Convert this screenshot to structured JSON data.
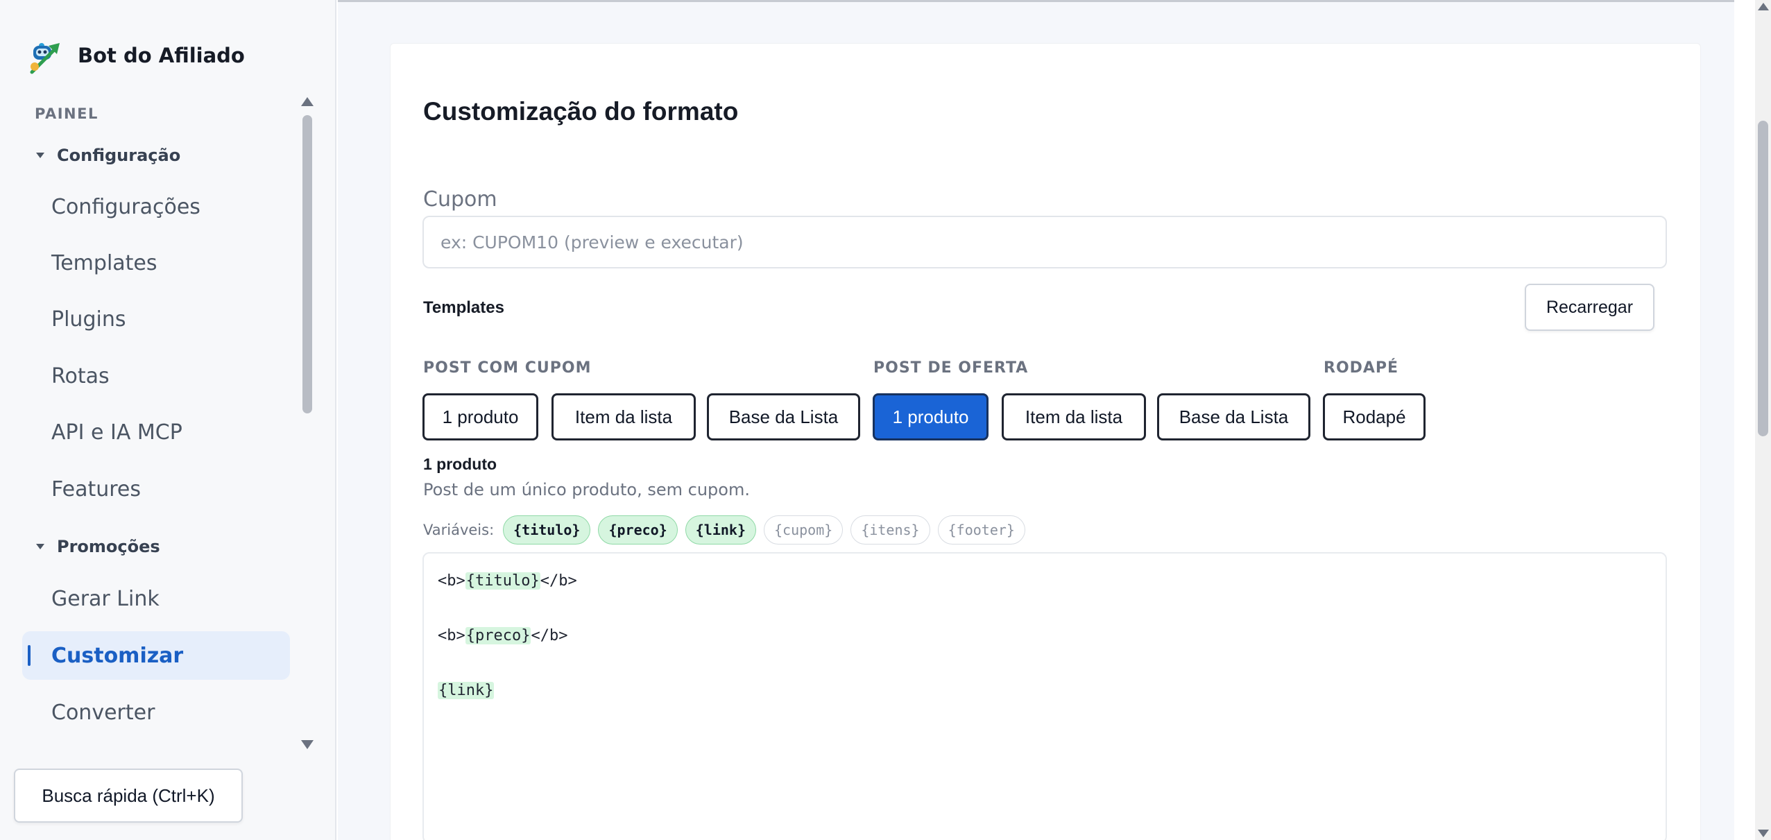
{
  "sidebar": {
    "brand_title": "Bot do Afiliado",
    "section_label": "PAINEL",
    "groups": [
      {
        "label": "Configuração",
        "items": [
          "Configurações",
          "Templates",
          "Plugins",
          "Rotas",
          "API e IA MCP",
          "Features"
        ]
      },
      {
        "label": "Promoções",
        "items": [
          "Gerar Link",
          "Customizar",
          "Converter"
        ]
      }
    ],
    "active_item": "Customizar",
    "quick_search_label": "Busca rápida (Ctrl+K)"
  },
  "main": {
    "page_title": "Customização do formato",
    "coupon": {
      "label": "Cupom",
      "placeholder": "ex: CUPOM10 (preview e executar)",
      "value": ""
    },
    "templates_section": {
      "title": "Templates",
      "reload_label": "Recarregar",
      "groups": [
        {
          "label": "POST COM CUPOM",
          "buttons": [
            "1 produto",
            "Item da lista",
            "Base da Lista"
          ]
        },
        {
          "label": "POST DE OFERTA",
          "buttons": [
            "1 produto",
            "Item da lista",
            "Base da Lista"
          ]
        },
        {
          "label": "RODAPÉ",
          "buttons": [
            "Rodapé"
          ]
        }
      ],
      "selected": "POST DE OFERTA / 1 produto"
    },
    "selected_template": {
      "name": "1 produto",
      "description": "Post de um único produto, sem cupom.",
      "variables_label": "Variáveis:",
      "variables": [
        {
          "name": "{titulo}",
          "used": true
        },
        {
          "name": "{preco}",
          "used": true
        },
        {
          "name": "{link}",
          "used": true
        },
        {
          "name": "{cupom}",
          "used": false
        },
        {
          "name": "{itens}",
          "used": false
        },
        {
          "name": "{footer}",
          "used": false
        }
      ],
      "code_lines": [
        {
          "before": "<b>",
          "var": "{titulo}",
          "after": "</b>"
        },
        {
          "before": "<b>",
          "var": "{preco}",
          "after": "</b>"
        },
        {
          "before": "",
          "var": "{link}",
          "after": ""
        }
      ]
    }
  },
  "colors": {
    "accent": "#1a64d6",
    "active_nav_bg": "#e6eefb",
    "active_nav_text": "#1a5fc4",
    "variable_highlight": "#d6f5df"
  },
  "icons": {
    "brand": "robot-rocket-icon",
    "group_toggle": "caret-down-icon"
  }
}
